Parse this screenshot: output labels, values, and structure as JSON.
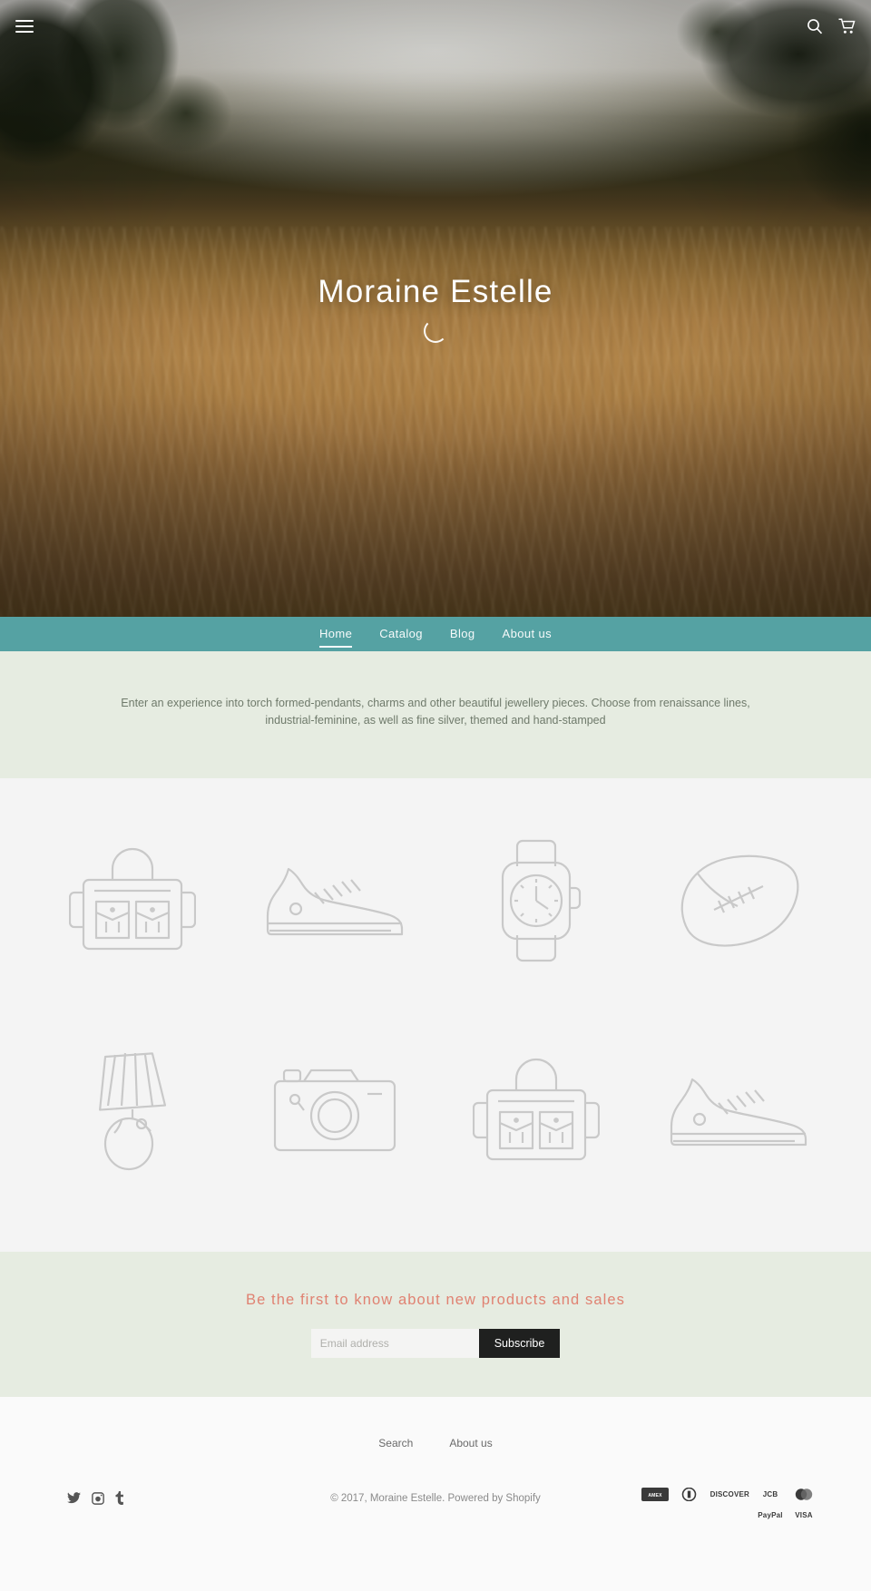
{
  "header": {
    "menu_icon": "hamburger-menu-icon",
    "search_icon": "search-icon",
    "cart_icon": "shopping-cart-icon"
  },
  "hero": {
    "title": "Moraine Estelle",
    "spinner": "loading-spinner"
  },
  "nav": {
    "items": [
      {
        "label": "Home",
        "active": true
      },
      {
        "label": "Catalog",
        "active": false
      },
      {
        "label": "Blog",
        "active": false
      },
      {
        "label": "About us",
        "active": false
      }
    ],
    "background_color": "#55a2a3"
  },
  "intro": {
    "text": "Enter an experience into torch formed-pendants, charms and other beautiful jewellery pieces. Choose from renaissance lines, industrial-feminine, as well as fine silver, themed and hand-stamped",
    "background_color": "#e6ece1"
  },
  "products": {
    "background_color": "#f4f4f4",
    "items": [
      {
        "icon": "bag-icon"
      },
      {
        "icon": "sneaker-icon"
      },
      {
        "icon": "watch-icon"
      },
      {
        "icon": "football-icon"
      },
      {
        "icon": "lamp-icon"
      },
      {
        "icon": "camera-icon"
      },
      {
        "icon": "bag-icon"
      },
      {
        "icon": "sneaker-icon"
      }
    ]
  },
  "newsletter": {
    "heading": "Be the first to know about new products and sales",
    "heading_color": "#e08272",
    "email_placeholder": "Email address",
    "email_value": "",
    "subscribe_label": "Subscribe",
    "background_color": "#e6ece1"
  },
  "footer": {
    "links": [
      {
        "label": "Search"
      },
      {
        "label": "About us"
      }
    ],
    "social": [
      {
        "icon": "twitter-icon"
      },
      {
        "icon": "instagram-icon"
      },
      {
        "icon": "tumblr-icon"
      }
    ],
    "copyright": "© 2017, Moraine Estelle. Powered by Shopify",
    "payments": [
      {
        "label": "AMEX",
        "name": "american-express-icon"
      },
      {
        "label": "DC",
        "name": "diners-club-icon"
      },
      {
        "label": "DISCOVER",
        "name": "discover-icon"
      },
      {
        "label": "JCB",
        "name": "jcb-icon"
      },
      {
        "label": "MC",
        "name": "mastercard-icon"
      },
      {
        "label": "PayPal",
        "name": "paypal-icon"
      },
      {
        "label": "VISA",
        "name": "visa-icon"
      }
    ]
  }
}
